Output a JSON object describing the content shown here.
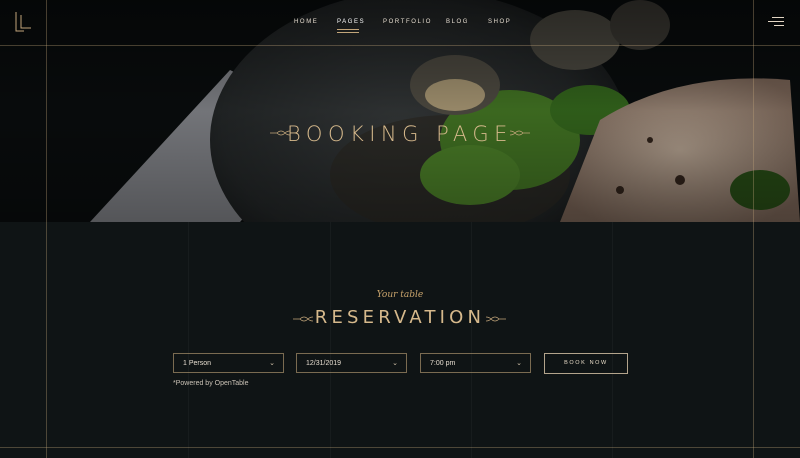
{
  "nav": {
    "items": [
      {
        "label": "HOME"
      },
      {
        "label": "PAGES"
      },
      {
        "label": "PORTFOLIO"
      },
      {
        "label": "BLOG"
      },
      {
        "label": "SHOP"
      }
    ]
  },
  "hero": {
    "title": "BOOKING PAGE"
  },
  "reservation": {
    "subtitle": "Your table",
    "title": "RESERVATION",
    "party_size": "1 Person",
    "date": "12/31/2019",
    "time": "7:00 pm",
    "book_button": "BOOK NOW",
    "powered_by": "*Powered by OpenTable"
  },
  "colors": {
    "accent": "#c2a57a",
    "background": "#0f1415"
  },
  "icons": {
    "logo": "logo-mark-icon",
    "menu": "hamburger-menu-icon",
    "dropdown": "chevron-down-icon",
    "flourish": "ornament-icon"
  }
}
